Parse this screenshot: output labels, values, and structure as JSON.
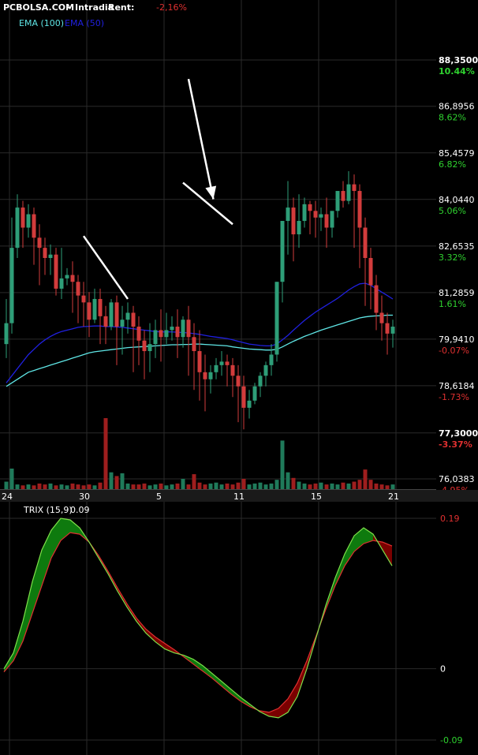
{
  "header": {
    "source": "PCBOLSA.COM",
    "separator": "-",
    "mode": "Intradia",
    "rent_label": "Rent:",
    "rent_value": "-2,16%"
  },
  "legend": {
    "ema100": "EMA (100)",
    "ema50": "EMA (50)"
  },
  "colors": {
    "background": "#000000",
    "grid": "#2a2a2a",
    "bull": "#2e9e78",
    "bear": "#d23c3c",
    "ema100": "#5fe6e6",
    "ema50": "#2020e0",
    "positive": "#2fd22f",
    "negative": "#e03030",
    "trix": "#7ee04a",
    "trix_signal": "#e03030",
    "trix_fill_up": "#0e7a0e",
    "trix_fill_down": "#7a0000",
    "arrows": "#ffffff"
  },
  "chart_data": [
    {
      "type": "candlestick",
      "title": "",
      "ylim": [
        76.0383,
        88.35
      ],
      "y_ticks": [
        {
          "price": "88,3500",
          "pct": "10.44%",
          "sign": "pos",
          "value": 88.35,
          "bold": true
        },
        {
          "price": "86,8956",
          "pct": "8.62%",
          "sign": "pos",
          "value": 86.8956
        },
        {
          "price": "85,4579",
          "pct": "6.82%",
          "sign": "pos",
          "value": 85.4579
        },
        {
          "price": "84,0440",
          "pct": "5.06%",
          "sign": "pos",
          "value": 84.044
        },
        {
          "price": "82,6535",
          "pct": "3.32%",
          "sign": "pos",
          "value": 82.6535
        },
        {
          "price": "81,2859",
          "pct": "1.61%",
          "sign": "pos",
          "value": 81.2859
        },
        {
          "price": "79,9410",
          "pct": "-0.07%",
          "sign": "neg",
          "value": 79.941
        },
        {
          "price": "78,6184",
          "pct": "-1.73%",
          "sign": "neg",
          "value": 78.6184
        },
        {
          "price": "77,3000",
          "pct": "-3.37%",
          "sign": "neg",
          "value": 77.3,
          "bold": true
        },
        {
          "price": "76,0383",
          "pct": "-4.95%",
          "sign": "neg",
          "value": 76.0383
        }
      ],
      "x_ticks": [
        {
          "label": "24",
          "index": 0
        },
        {
          "label": "30",
          "index": 14
        },
        {
          "label": "5",
          "index": 28
        },
        {
          "label": "11",
          "index": 42
        },
        {
          "label": "15",
          "index": 56
        },
        {
          "label": "21",
          "index": 70
        }
      ],
      "candles": [
        [
          79.8,
          81.1,
          80.4,
          79.4
        ],
        [
          80.4,
          83.5,
          82.6,
          80.1
        ],
        [
          82.6,
          84.2,
          83.8,
          82.3
        ],
        [
          83.8,
          84.0,
          83.2,
          82.6
        ],
        [
          83.2,
          83.9,
          83.6,
          82.9
        ],
        [
          83.6,
          83.8,
          82.9,
          82.1
        ],
        [
          82.9,
          83.3,
          82.6,
          81.5
        ],
        [
          82.6,
          82.9,
          82.3,
          81.8
        ],
        [
          82.3,
          82.7,
          82.4,
          81.8
        ],
        [
          82.4,
          82.6,
          81.4,
          81.2
        ],
        [
          81.4,
          82.6,
          81.7,
          81.1
        ],
        [
          81.7,
          82.0,
          81.8,
          81.5
        ],
        [
          81.8,
          82.2,
          81.6,
          80.7
        ],
        [
          81.6,
          81.8,
          81.2,
          80.4
        ],
        [
          81.2,
          81.6,
          81.0,
          80.3
        ],
        [
          81.0,
          81.3,
          80.5,
          80.0
        ],
        [
          80.5,
          81.4,
          81.1,
          80.4
        ],
        [
          81.1,
          81.4,
          80.6,
          79.8
        ],
        [
          80.6,
          80.9,
          80.3,
          79.8
        ],
        [
          80.3,
          81.1,
          81.0,
          80.2
        ],
        [
          81.0,
          81.2,
          80.3,
          79.2
        ],
        [
          80.3,
          80.9,
          80.5,
          79.5
        ],
        [
          80.5,
          81.0,
          80.7,
          80.1
        ],
        [
          80.7,
          80.9,
          80.3,
          79.0
        ],
        [
          80.3,
          80.6,
          79.9,
          79.2
        ],
        [
          79.9,
          80.2,
          79.6,
          78.8
        ],
        [
          79.6,
          80.4,
          79.8,
          79.0
        ],
        [
          79.8,
          80.5,
          80.2,
          79.4
        ],
        [
          80.2,
          80.8,
          80.0,
          79.3
        ],
        [
          80.0,
          80.7,
          80.2,
          79.8
        ],
        [
          80.2,
          80.6,
          80.3,
          79.9
        ],
        [
          80.3,
          80.8,
          80.0,
          79.4
        ],
        [
          80.0,
          80.6,
          80.5,
          79.7
        ],
        [
          80.5,
          80.9,
          80.0,
          78.9
        ],
        [
          80.0,
          80.4,
          79.6,
          78.5
        ],
        [
          79.6,
          80.2,
          79.0,
          78.2
        ],
        [
          79.0,
          79.5,
          78.8,
          77.9
        ],
        [
          78.8,
          79.2,
          79.0,
          78.4
        ],
        [
          79.0,
          79.4,
          79.2,
          78.8
        ],
        [
          79.2,
          79.6,
          79.3,
          78.9
        ],
        [
          79.3,
          79.5,
          79.2,
          78.6
        ],
        [
          79.2,
          79.4,
          78.9,
          78.3
        ],
        [
          78.9,
          79.2,
          78.6,
          77.6
        ],
        [
          78.6,
          78.9,
          78.0,
          77.4
        ],
        [
          78.0,
          78.5,
          78.2,
          77.7
        ],
        [
          78.2,
          78.7,
          78.6,
          78.1
        ],
        [
          78.6,
          79.0,
          78.9,
          78.3
        ],
        [
          78.9,
          79.3,
          79.2,
          78.6
        ],
        [
          79.2,
          79.8,
          79.5,
          78.9
        ],
        [
          79.5,
          81.6,
          81.6,
          79.3
        ],
        [
          81.6,
          83.3,
          83.4,
          81.0
        ],
        [
          83.4,
          84.6,
          83.8,
          82.4
        ],
        [
          83.8,
          84.1,
          83.0,
          82.2
        ],
        [
          83.0,
          84.2,
          83.4,
          82.6
        ],
        [
          83.4,
          84.1,
          83.9,
          83.2
        ],
        [
          83.9,
          84.0,
          83.7,
          83.0
        ],
        [
          83.7,
          84.0,
          83.5,
          82.9
        ],
        [
          83.5,
          83.8,
          83.6,
          83.1
        ],
        [
          83.6,
          84.1,
          83.2,
          82.6
        ],
        [
          83.2,
          83.6,
          83.7,
          82.9
        ],
        [
          83.7,
          84.2,
          84.3,
          83.5
        ],
        [
          84.3,
          84.6,
          84.0,
          83.8
        ],
        [
          84.0,
          84.9,
          84.5,
          83.9
        ],
        [
          84.5,
          84.8,
          84.3,
          82.6
        ],
        [
          84.3,
          84.5,
          83.2,
          82.0
        ],
        [
          83.2,
          83.5,
          82.3,
          80.9
        ],
        [
          82.3,
          82.6,
          81.5,
          80.8
        ],
        [
          81.5,
          81.8,
          80.7,
          80.2
        ],
        [
          80.7,
          81.2,
          80.4,
          79.9
        ],
        [
          80.4,
          80.7,
          80.1,
          79.5
        ],
        [
          80.1,
          80.5,
          80.3,
          79.7
        ]
      ],
      "volumes": [
        0.8,
        2.2,
        0.5,
        0.4,
        0.5,
        0.4,
        0.6,
        0.5,
        0.6,
        0.4,
        0.5,
        0.4,
        0.6,
        0.5,
        0.4,
        0.5,
        0.4,
        0.7,
        7.6,
        1.8,
        1.4,
        1.7,
        0.6,
        0.5,
        0.5,
        0.6,
        0.4,
        0.5,
        0.6,
        0.4,
        0.5,
        0.6,
        1.1,
        0.5,
        1.6,
        0.7,
        0.5,
        0.6,
        0.7,
        0.5,
        0.6,
        0.5,
        0.7,
        1.1,
        0.5,
        0.6,
        0.7,
        0.5,
        0.6,
        1.0,
        5.2,
        1.8,
        1.2,
        0.8,
        0.6,
        0.5,
        0.6,
        0.7,
        0.5,
        0.6,
        0.5,
        0.7,
        0.6,
        0.8,
        1.0,
        2.1,
        1.0,
        0.6,
        0.5,
        0.4,
        0.5
      ],
      "ema100": [
        78.6,
        78.7,
        78.8,
        78.9,
        79.0,
        79.05,
        79.1,
        79.15,
        79.2,
        79.25,
        79.3,
        79.35,
        79.4,
        79.45,
        79.5,
        79.55,
        79.58,
        79.6,
        79.62,
        79.64,
        79.66,
        79.68,
        79.7,
        79.71,
        79.72,
        79.73,
        79.74,
        79.75,
        79.76,
        79.77,
        79.78,
        79.78,
        79.79,
        79.79,
        79.8,
        79.8,
        79.79,
        79.78,
        79.77,
        79.76,
        79.75,
        79.72,
        79.7,
        79.68,
        79.66,
        79.65,
        79.64,
        79.63,
        79.63,
        79.65,
        79.72,
        79.8,
        79.88,
        79.95,
        80.02,
        80.08,
        80.14,
        80.2,
        80.25,
        80.3,
        80.35,
        80.4,
        80.45,
        80.5,
        80.55,
        80.58,
        80.6,
        80.61,
        80.62,
        80.63,
        80.63
      ],
      "ema50": [
        78.7,
        78.9,
        79.1,
        79.3,
        79.5,
        79.65,
        79.8,
        79.92,
        80.02,
        80.1,
        80.16,
        80.2,
        80.24,
        80.28,
        80.3,
        80.31,
        80.32,
        80.32,
        80.3,
        80.3,
        80.29,
        80.28,
        80.26,
        80.24,
        80.22,
        80.2,
        80.18,
        80.16,
        80.15,
        80.15,
        80.15,
        80.14,
        80.13,
        80.12,
        80.1,
        80.08,
        80.05,
        80.02,
        80.0,
        79.98,
        79.96,
        79.92,
        79.88,
        79.84,
        79.8,
        79.78,
        79.76,
        79.75,
        79.75,
        79.8,
        79.92,
        80.05,
        80.2,
        80.34,
        80.48,
        80.6,
        80.72,
        80.82,
        80.92,
        81.02,
        81.12,
        81.24,
        81.36,
        81.46,
        81.54,
        81.56,
        81.5,
        81.4,
        81.3,
        81.2,
        81.1
      ]
    },
    {
      "type": "line",
      "title": "TRIX (15,9)",
      "current_value": "0.09",
      "ylim": [
        -0.09,
        0.19
      ],
      "y_ticks": [
        {
          "label": "0.19",
          "value": 0.19,
          "sign": "neg"
        },
        {
          "label": "0",
          "value": 0,
          "sign": "neutral"
        },
        {
          "label": "-0.09",
          "value": -0.09,
          "sign": "pos"
        }
      ],
      "series": [
        {
          "key": "trix",
          "values": [
            0.0,
            0.02,
            0.06,
            0.11,
            0.15,
            0.175,
            0.19,
            0.188,
            0.178,
            0.16,
            0.14,
            0.12,
            0.098,
            0.078,
            0.06,
            0.045,
            0.034,
            0.025,
            0.02,
            0.017,
            0.012,
            0.004,
            -0.006,
            -0.016,
            -0.026,
            -0.036,
            -0.045,
            -0.054,
            -0.06,
            -0.062,
            -0.055,
            -0.035,
            0.0,
            0.04,
            0.08,
            0.115,
            0.145,
            0.168,
            0.178,
            0.17,
            0.15,
            0.13
          ]
        },
        {
          "key": "signal",
          "values": [
            -0.004,
            0.01,
            0.035,
            0.07,
            0.105,
            0.14,
            0.162,
            0.172,
            0.17,
            0.16,
            0.143,
            0.123,
            0.102,
            0.082,
            0.064,
            0.05,
            0.04,
            0.032,
            0.024,
            0.015,
            0.006,
            -0.003,
            -0.012,
            -0.022,
            -0.032,
            -0.041,
            -0.048,
            -0.053,
            -0.055,
            -0.05,
            -0.038,
            -0.018,
            0.01,
            0.042,
            0.075,
            0.105,
            0.13,
            0.148,
            0.158,
            0.162,
            0.16,
            0.155
          ]
        }
      ]
    }
  ],
  "annotations": {
    "arrows": [
      {
        "from": [
          2.0,
          82.95
        ],
        "to": [
          10.0,
          81.1
        ],
        "arrowhead": false
      },
      {
        "from": [
          20.0,
          84.55
        ],
        "to": [
          29.0,
          83.3
        ],
        "arrowhead": false
      },
      {
        "from": [
          21.0,
          87.75
        ],
        "to": [
          25.5,
          84.05
        ],
        "arrowhead": true
      }
    ]
  }
}
